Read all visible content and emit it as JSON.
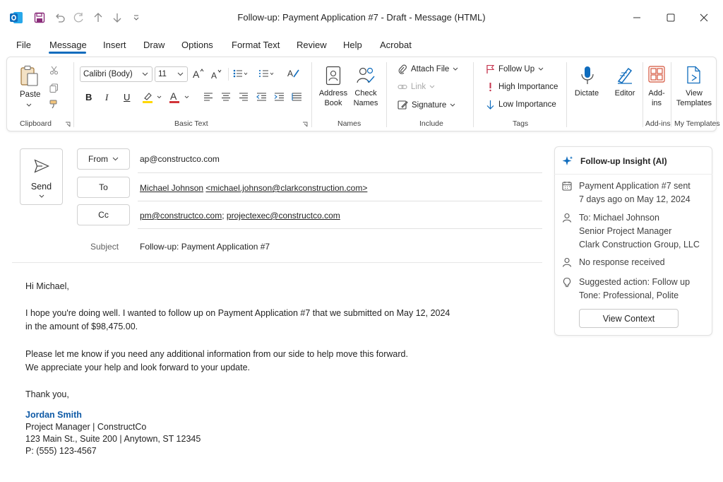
{
  "window": {
    "title": "Follow-up: Payment Application #7  -  Draft  -  Message (HTML)"
  },
  "menu": {
    "tabs": [
      "File",
      "Message",
      "Insert",
      "Draw",
      "Options",
      "Format Text",
      "Review",
      "Help",
      "Acrobat"
    ],
    "active": "Message"
  },
  "ribbon": {
    "clipboard": {
      "paste": "Paste",
      "label": "Clipboard"
    },
    "basic_text": {
      "font": "Calibri (Body)",
      "size": "11",
      "label": "Basic Text"
    },
    "names": {
      "address_book_1": "Address",
      "address_book_2": "Book",
      "check_names_1": "Check",
      "check_names_2": "Names",
      "label": "Names"
    },
    "include": {
      "attach_file": "Attach File",
      "link": "Link",
      "signature": "Signature",
      "label": "Include"
    },
    "tags": {
      "follow_up": "Follow Up",
      "high": "High Importance",
      "low": "Low Importance",
      "label": "Tags"
    },
    "dictate": "Dictate",
    "editor": "Editor",
    "addins": {
      "line1": "Add-",
      "line2": "ins",
      "label": "Add-ins"
    },
    "templates": {
      "line1": "View",
      "line2": "Templates",
      "label": "My Templates"
    },
    "colors": {
      "highlight": "#ffd800",
      "font_color": "#d13438",
      "accent": "#0f6cbd"
    }
  },
  "compose": {
    "send": "Send",
    "from_label": "From",
    "from_value": "ap@constructco.com",
    "to_label": "To",
    "to_name": "Michael Johnson",
    "to_email": "<michael.johnson@clarkconstruction.com>",
    "cc_label": "Cc",
    "cc_1": "pm@constructco.com",
    "cc_sep": "; ",
    "cc_2": "projectexec@constructco.com",
    "subject_label": "Subject",
    "subject_value": "Follow-up: Payment Application #7"
  },
  "body": {
    "greeting": "Hi Michael,",
    "p1_line1": "I hope you're doing well. I wanted to follow up on Payment Application #7 that we submitted on May 12, 2024",
    "p1_line2": "in the amount of $98,475.00.",
    "p2_line1": "Please let me know if you need any additional information from our side to help move this forward.",
    "p2_line2": "We appreciate your help and look forward to your update.",
    "closing": "Thank you,",
    "sig_name": "Jordan Smith",
    "sig_title": "Project Manager | ConstructCo",
    "sig_address": "123 Main St., Suite 200 | Anytown, ST 12345",
    "sig_phone": "P: (555) 123-4567"
  },
  "insight": {
    "title": "Follow-up Insight (AI)",
    "sent_1": "Payment Application #7 sent",
    "sent_2": "7 days ago on May 12, 2024",
    "to_1": "To: Michael Johnson",
    "to_2": "Senior Project Manager",
    "to_3": "Clark Construction Group, LLC",
    "response": "No response received",
    "action_1": "Suggested action: Follow up",
    "action_2": "Tone: Professional, Polite",
    "button": "View Context"
  }
}
